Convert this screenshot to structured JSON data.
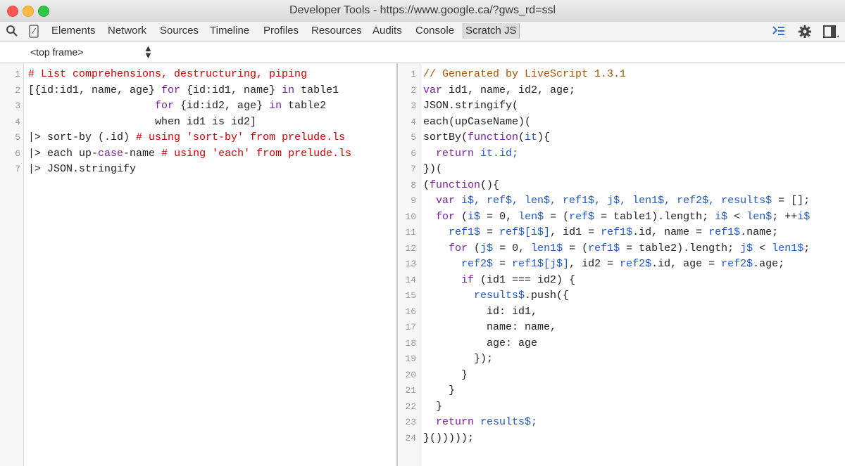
{
  "window": {
    "title": "Developer Tools - https://www.google.ca/?gws_rd=ssl",
    "lights": [
      {
        "name": "close",
        "color": "#fc5753"
      },
      {
        "name": "minimize",
        "color": "#fdbc40"
      },
      {
        "name": "maximize",
        "color": "#33c748"
      }
    ]
  },
  "toolbar": {
    "tabs": [
      "Elements",
      "Network",
      "Sources",
      "Timeline",
      "Profiles",
      "Resources",
      "Audits",
      "Console",
      "Scratch JS"
    ],
    "active_tab": "Scratch JS"
  },
  "frame_selector": {
    "value": "<top frame>",
    "arrow": "▲▼"
  },
  "left_editor": {
    "lines": [
      {
        "n": "1",
        "tokens": [
          {
            "t": "# List comprehensions, destructuring, piping",
            "c": "comment"
          }
        ]
      },
      {
        "n": "2",
        "tokens": [
          {
            "t": "[{id:id1, name, age} ",
            "c": "plain"
          },
          {
            "t": "for",
            "c": "keyword"
          },
          {
            "t": " {id:id1, name} ",
            "c": "plain"
          },
          {
            "t": "in",
            "c": "keyword"
          },
          {
            "t": " table1",
            "c": "plain"
          }
        ]
      },
      {
        "n": "3",
        "tokens": [
          {
            "t": "                    ",
            "c": "plain"
          },
          {
            "t": "for",
            "c": "keyword"
          },
          {
            "t": " {id:id2, age} ",
            "c": "plain"
          },
          {
            "t": "in",
            "c": "keyword"
          },
          {
            "t": " table2",
            "c": "plain"
          }
        ]
      },
      {
        "n": "4",
        "tokens": [
          {
            "t": "                    when id1 is id2]",
            "c": "plain"
          }
        ]
      },
      {
        "n": "5",
        "tokens": [
          {
            "t": "|> sort-by (.id) ",
            "c": "plain"
          },
          {
            "t": "# using ",
            "c": "comment"
          },
          {
            "t": "'sort-by'",
            "c": "string"
          },
          {
            "t": " from prelude.ls",
            "c": "comment"
          }
        ]
      },
      {
        "n": "6",
        "tokens": [
          {
            "t": "|> each up-",
            "c": "plain"
          },
          {
            "t": "case",
            "c": "keyword"
          },
          {
            "t": "-name ",
            "c": "plain"
          },
          {
            "t": "# using ",
            "c": "comment"
          },
          {
            "t": "'each'",
            "c": "string"
          },
          {
            "t": " from prelude.ls",
            "c": "comment"
          }
        ]
      },
      {
        "n": "7",
        "tokens": [
          {
            "t": "|> JSON.stringify",
            "c": "plain"
          }
        ]
      }
    ]
  },
  "right_editor": {
    "lines": [
      {
        "n": "1",
        "tokens": [
          {
            "t": "// Generated by LiveScript 1.3.1",
            "c": "comment2"
          }
        ]
      },
      {
        "n": "2",
        "tokens": [
          {
            "t": "var",
            "c": "keyword"
          },
          {
            "t": " id1, name, id2, age;",
            "c": "plain"
          }
        ]
      },
      {
        "n": "3",
        "tokens": [
          {
            "t": "JSON.stringify(",
            "c": "plain"
          }
        ]
      },
      {
        "n": "4",
        "tokens": [
          {
            "t": "each(upCaseName)(",
            "c": "plain"
          }
        ]
      },
      {
        "n": "5",
        "tokens": [
          {
            "t": "sortBy(",
            "c": "plain"
          },
          {
            "t": "function",
            "c": "keyword"
          },
          {
            "t": "(",
            "c": "plain"
          },
          {
            "t": "it",
            "c": "var"
          },
          {
            "t": "){",
            "c": "plain"
          }
        ]
      },
      {
        "n": "6",
        "tokens": [
          {
            "t": "  ",
            "c": "plain"
          },
          {
            "t": "return",
            "c": "keyword"
          },
          {
            "t": " it.id;",
            "c": "var"
          }
        ]
      },
      {
        "n": "7",
        "tokens": [
          {
            "t": "})(",
            "c": "plain"
          }
        ]
      },
      {
        "n": "8",
        "tokens": [
          {
            "t": "(",
            "c": "plain"
          },
          {
            "t": "function",
            "c": "keyword"
          },
          {
            "t": "(){",
            "c": "plain"
          }
        ]
      },
      {
        "n": "9",
        "tokens": [
          {
            "t": "  ",
            "c": "plain"
          },
          {
            "t": "var",
            "c": "keyword"
          },
          {
            "t": " i$, ref$, len$, ref1$, j$, len1$, ref2$, results$",
            "c": "var"
          },
          {
            "t": " = [];",
            "c": "plain"
          }
        ]
      },
      {
        "n": "10",
        "tokens": [
          {
            "t": "  ",
            "c": "plain"
          },
          {
            "t": "for",
            "c": "keyword"
          },
          {
            "t": " (",
            "c": "plain"
          },
          {
            "t": "i$",
            "c": "var"
          },
          {
            "t": " = 0, ",
            "c": "plain"
          },
          {
            "t": "len$",
            "c": "var"
          },
          {
            "t": " = (",
            "c": "plain"
          },
          {
            "t": "ref$",
            "c": "var"
          },
          {
            "t": " = table1).length; ",
            "c": "plain"
          },
          {
            "t": "i$",
            "c": "var"
          },
          {
            "t": " < ",
            "c": "plain"
          },
          {
            "t": "len$",
            "c": "var"
          },
          {
            "t": "; ++",
            "c": "plain"
          },
          {
            "t": "i$",
            "c": "var"
          }
        ]
      },
      {
        "n": "11",
        "tokens": [
          {
            "t": "    ",
            "c": "plain"
          },
          {
            "t": "ref1$",
            "c": "var"
          },
          {
            "t": " = ",
            "c": "plain"
          },
          {
            "t": "ref$[i$]",
            "c": "var"
          },
          {
            "t": ", id1 = ",
            "c": "plain"
          },
          {
            "t": "ref1$",
            "c": "var"
          },
          {
            "t": ".id, name = ",
            "c": "plain"
          },
          {
            "t": "ref1$",
            "c": "var"
          },
          {
            "t": ".name;",
            "c": "plain"
          }
        ]
      },
      {
        "n": "12",
        "tokens": [
          {
            "t": "    ",
            "c": "plain"
          },
          {
            "t": "for",
            "c": "keyword"
          },
          {
            "t": " (",
            "c": "plain"
          },
          {
            "t": "j$",
            "c": "var"
          },
          {
            "t": " = 0, ",
            "c": "plain"
          },
          {
            "t": "len1$",
            "c": "var"
          },
          {
            "t": " = (",
            "c": "plain"
          },
          {
            "t": "ref1$",
            "c": "var"
          },
          {
            "t": " = table2).length; ",
            "c": "plain"
          },
          {
            "t": "j$",
            "c": "var"
          },
          {
            "t": " < ",
            "c": "plain"
          },
          {
            "t": "len1$",
            "c": "var"
          },
          {
            "t": ";",
            "c": "plain"
          }
        ]
      },
      {
        "n": "13",
        "tokens": [
          {
            "t": "      ",
            "c": "plain"
          },
          {
            "t": "ref2$",
            "c": "var"
          },
          {
            "t": " = ",
            "c": "plain"
          },
          {
            "t": "ref1$[j$]",
            "c": "var"
          },
          {
            "t": ", id2 = ",
            "c": "plain"
          },
          {
            "t": "ref2$",
            "c": "var"
          },
          {
            "t": ".id, age = ",
            "c": "plain"
          },
          {
            "t": "ref2$",
            "c": "var"
          },
          {
            "t": ".age;",
            "c": "plain"
          }
        ]
      },
      {
        "n": "14",
        "tokens": [
          {
            "t": "      ",
            "c": "plain"
          },
          {
            "t": "if",
            "c": "keyword"
          },
          {
            "t": " (id1 === id2) {",
            "c": "plain"
          }
        ]
      },
      {
        "n": "15",
        "tokens": [
          {
            "t": "        ",
            "c": "plain"
          },
          {
            "t": "results$",
            "c": "var"
          },
          {
            "t": ".push({",
            "c": "plain"
          }
        ]
      },
      {
        "n": "16",
        "tokens": [
          {
            "t": "          id: id1,",
            "c": "plain"
          }
        ]
      },
      {
        "n": "17",
        "tokens": [
          {
            "t": "          name: name,",
            "c": "plain"
          }
        ]
      },
      {
        "n": "18",
        "tokens": [
          {
            "t": "          age: age",
            "c": "plain"
          }
        ]
      },
      {
        "n": "19",
        "tokens": [
          {
            "t": "        });",
            "c": "plain"
          }
        ]
      },
      {
        "n": "20",
        "tokens": [
          {
            "t": "      }",
            "c": "plain"
          }
        ]
      },
      {
        "n": "21",
        "tokens": [
          {
            "t": "    }",
            "c": "plain"
          }
        ]
      },
      {
        "n": "22",
        "tokens": [
          {
            "t": "  }",
            "c": "plain"
          }
        ]
      },
      {
        "n": "23",
        "tokens": [
          {
            "t": "  ",
            "c": "plain"
          },
          {
            "t": "return",
            "c": "keyword"
          },
          {
            "t": " results$;",
            "c": "var"
          }
        ]
      },
      {
        "n": "24",
        "tokens": [
          {
            "t": "}()))));",
            "c": "plain"
          }
        ]
      }
    ]
  }
}
